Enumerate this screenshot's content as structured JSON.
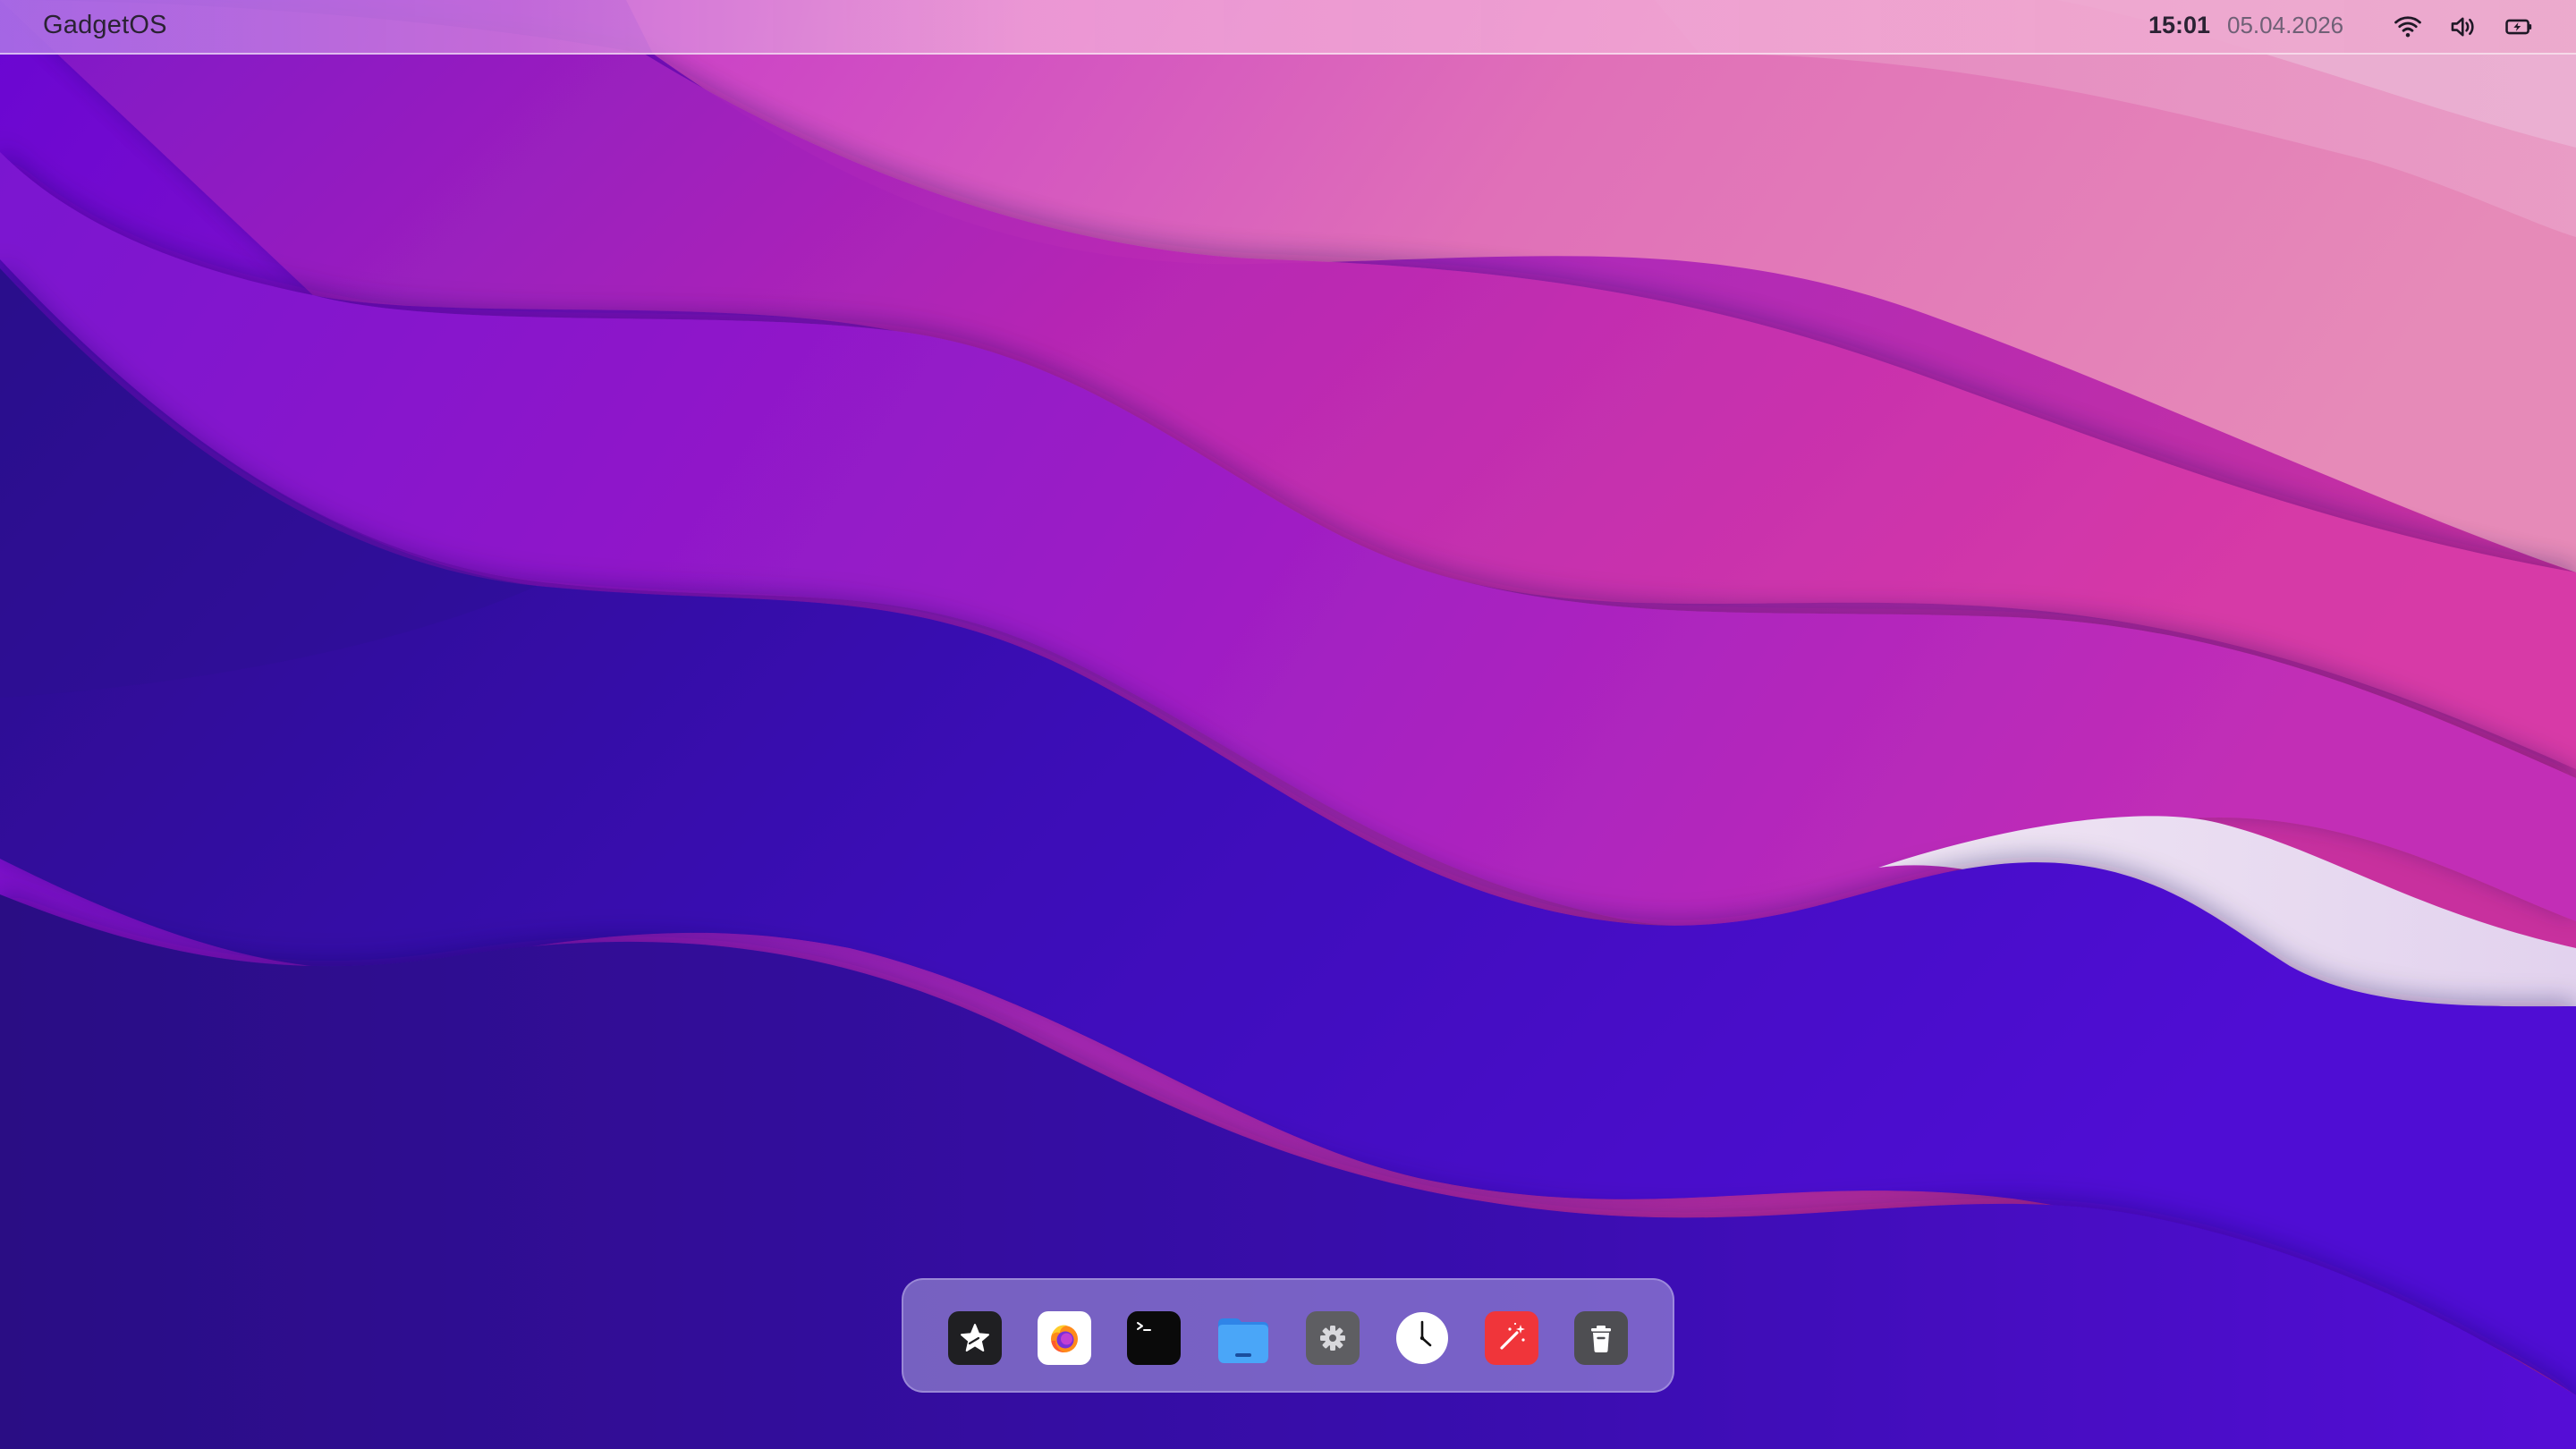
{
  "menubar": {
    "title": "GadgetOS",
    "time": "15:01",
    "date": "05.04.2026",
    "tray_icons": [
      "wifi-icon",
      "volume-icon",
      "battery-icon"
    ]
  },
  "dock": {
    "items": [
      {
        "name": "app-store",
        "icon": "star-icon",
        "color": "#1f1f22"
      },
      {
        "name": "browser",
        "icon": "firefox-icon",
        "color": "#ffffff"
      },
      {
        "name": "terminal",
        "icon": "terminal-icon",
        "color": "#0a0a0a"
      },
      {
        "name": "files",
        "icon": "folder-icon",
        "color": "#3d9bf5"
      },
      {
        "name": "settings",
        "icon": "gear-icon",
        "color": "#5e5e62"
      },
      {
        "name": "clock",
        "icon": "clock-icon",
        "color": "#ffffff"
      },
      {
        "name": "photo-editor",
        "icon": "magic-wand-icon",
        "color": "#f0353a"
      },
      {
        "name": "trash",
        "icon": "trash-icon",
        "color": "#4e4e52"
      }
    ]
  },
  "wallpaper": {
    "colors": [
      "#6a06d2",
      "#2a0f86",
      "#d040b8",
      "#e890c0",
      "#e8ddf0",
      "#4a05cc"
    ]
  }
}
